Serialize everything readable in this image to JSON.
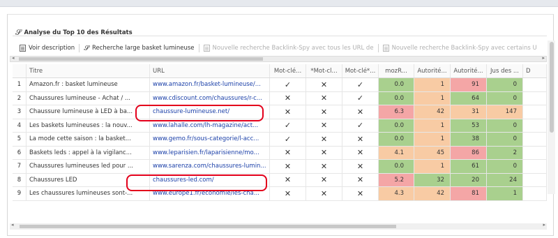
{
  "section": {
    "title": "Analyse du Top 10 des Résultats",
    "icon": "magnifier-icon"
  },
  "toolbar": {
    "voir_description": "Voir description",
    "recherche_large": "Recherche large basket lumineuse",
    "nouvelle_1": "Nouvelle recherche Backlink-Spy avec tous les URL de",
    "nouvelle_2": "Nouvelle recherche Backlink-Spy avec certains U"
  },
  "columns": [
    "",
    "Titre",
    "URL",
    "Mot-clé...",
    "*Mot-cl...",
    "Mot-clé*...",
    "mozR...",
    "Autorité...",
    "Autorité...",
    "Jus des ...",
    "D"
  ],
  "rows": [
    {
      "n": "1",
      "title": "Amazon.fr : basket lumineuse",
      "url": "www.amazon.fr/basket-lumineuse/...",
      "m1": "✓",
      "m2": "✕",
      "m3": "✓",
      "moz": "0.0",
      "a1": "1",
      "a2": "91",
      "jus": "0",
      "colors": [
        "g",
        "o",
        "p",
        "g"
      ]
    },
    {
      "n": "2",
      "title": "Chaussures lumineuse - Achat / ...",
      "url": "www.cdiscount.com/chaussures/r-c...",
      "m1": "✕",
      "m2": "✕",
      "m3": "✓",
      "moz": "0.0",
      "a1": "1",
      "a2": "64",
      "jus": "0",
      "colors": [
        "g",
        "o",
        "g",
        "g"
      ]
    },
    {
      "n": "3",
      "title": "Chaussure lumineuse à LED à ba...",
      "url": "chaussure-lumineuse.net/",
      "m1": "✕",
      "m2": "✕",
      "m3": "✕",
      "moz": "6.3",
      "a1": "42",
      "a2": "31",
      "jus": "147",
      "colors": [
        "p",
        "o",
        "o",
        "o"
      ]
    },
    {
      "n": "4",
      "title": "Les baskets lumineuses : la nouv...",
      "url": "www.lahalle.com/lh-magazine/act...",
      "m1": "✓",
      "m2": "✕",
      "m3": "✓",
      "moz": "0.0",
      "a1": "1",
      "a2": "53",
      "jus": "0",
      "colors": [
        "g",
        "o",
        "g",
        "g"
      ]
    },
    {
      "n": "5",
      "title": "La mode cette saison : la basket...",
      "url": "www.gemo.fr/sous-categorie/l-acc...",
      "m1": "✓",
      "m2": "✕",
      "m3": "✕",
      "moz": "0.0",
      "a1": "1",
      "a2": "38",
      "jus": "0",
      "colors": [
        "g",
        "o",
        "g",
        "g"
      ]
    },
    {
      "n": "6",
      "title": "Baskets leds : appel à la vigilanc...",
      "url": "www.leparisien.fr/laparisienne/mo...",
      "m1": "✕",
      "m2": "✕",
      "m3": "✕",
      "moz": "4.1",
      "a1": "45",
      "a2": "86",
      "jus": "2",
      "colors": [
        "o",
        "o",
        "p",
        "g"
      ]
    },
    {
      "n": "7",
      "title": "Chaussures lumineuses led pour ...",
      "url": "www.sarenza.com/chaussures-lumin...",
      "m1": "✕",
      "m2": "✕",
      "m3": "✕",
      "moz": "0.0",
      "a1": "1",
      "a2": "61",
      "jus": "0",
      "colors": [
        "g",
        "o",
        "g",
        "g"
      ]
    },
    {
      "n": "8",
      "title": "Chaussures LED",
      "url": "chaussures-led.com/",
      "m1": "✕",
      "m2": "✕",
      "m3": "✕",
      "moz": "5.2",
      "a1": "32",
      "a2": "20",
      "jus": "24",
      "colors": [
        "p",
        "g",
        "g",
        "g"
      ]
    },
    {
      "n": "9",
      "title": "Les chaussures lumineuses sont-...",
      "url": "www.europe1.fr/economie/les-cha...",
      "m1": "✕",
      "m2": "✕",
      "m3": "✕",
      "moz": "4.3",
      "a1": "42",
      "a2": "81",
      "jus": "1",
      "colors": [
        "o",
        "o",
        "p",
        "g"
      ]
    }
  ],
  "colors": {
    "green": "#a9d08e",
    "orange": "#f8cba4",
    "pink": "#f4a6a6",
    "highlight": "#e3001b",
    "link": "#1a3fa8"
  }
}
